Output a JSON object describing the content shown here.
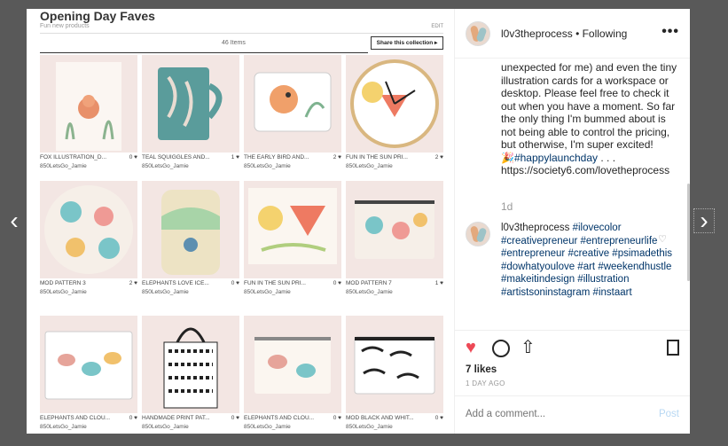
{
  "nav": {
    "prev": "‹",
    "next": "›"
  },
  "board": {
    "title": "Opening Day Faves",
    "subtitle": "Fun new products",
    "edit": "EDIT",
    "count": "46 Items",
    "share": "Share this collection ▸"
  },
  "products": [
    {
      "name": "FOX ILLUSTRATION_D...",
      "likes": "0 ♥",
      "user": "850LetsGo_Jamie"
    },
    {
      "name": "TEAL SQUIGGLES AND...",
      "likes": "1 ♥",
      "user": "850LetsGo_Jamie"
    },
    {
      "name": "THE EARLY BIRD AND...",
      "likes": "2 ♥",
      "user": "850LetsGo_Jamie"
    },
    {
      "name": "FUN IN THE SUN PRI...",
      "likes": "2 ♥",
      "user": "850LetsGo_Jamie"
    },
    {
      "name": "MOD PATTERN 3",
      "likes": "2 ♥",
      "user": "850LetsGo_Jamie"
    },
    {
      "name": "ELEPHANTS LOVE ICE...",
      "likes": "0 ♥",
      "user": "850LetsGo_Jamie"
    },
    {
      "name": "FUN IN THE SUN PRI...",
      "likes": "0 ♥",
      "user": "850LetsGo_Jamie"
    },
    {
      "name": "MOD PATTERN 7",
      "likes": "1 ♥",
      "user": "850LetsGo_Jamie"
    },
    {
      "name": "ELEPHANTS AND CLOU...",
      "likes": "0 ♥",
      "user": "850LetsGo_Jamie"
    },
    {
      "name": "HANDMADE PRINT PAT...",
      "likes": "0 ♥",
      "user": "850LetsGo_Jamie"
    },
    {
      "name": "ELEPHANTS AND CLOU...",
      "likes": "0 ♥",
      "user": "850LetsGo_Jamie"
    },
    {
      "name": "MOD BLACK AND WHIT...",
      "likes": "0 ♥",
      "user": "850LetsGo_Jamie"
    }
  ],
  "post": {
    "username": "l0v3theprocess",
    "follow_status": "• Following",
    "more": "•••",
    "caption_text": "unexpected for me) and even the tiny illustration cards for a workspace or desktop. Please feel free to check it out when you have a moment. So far the only thing I'm bummed about is not being able to control the pricing, but otherwise, I'm super excited!",
    "caption_emoji": "🎉",
    "caption_tag": "#happylaunchday",
    "caption_dots": ". . .",
    "caption_url": "https://society6.com/lovetheprocess",
    "caption_time": "1d",
    "comment_user": "l0v3theprocess",
    "comment_tags": "#ilovecolor #creativepreneur #entrepreneurlife #entrepreneur #creative #psimadethis #dowhatyoulove #art #weekendhustle #makeitindesign #illustration #artistsoninstagram #instaart",
    "likes": "7 likes",
    "date": "1 DAY AGO",
    "comment_placeholder": "Add a comment...",
    "post_label": "Post"
  },
  "colors": {
    "like": "#ed4956",
    "link": "#003569",
    "muted": "#999999"
  }
}
